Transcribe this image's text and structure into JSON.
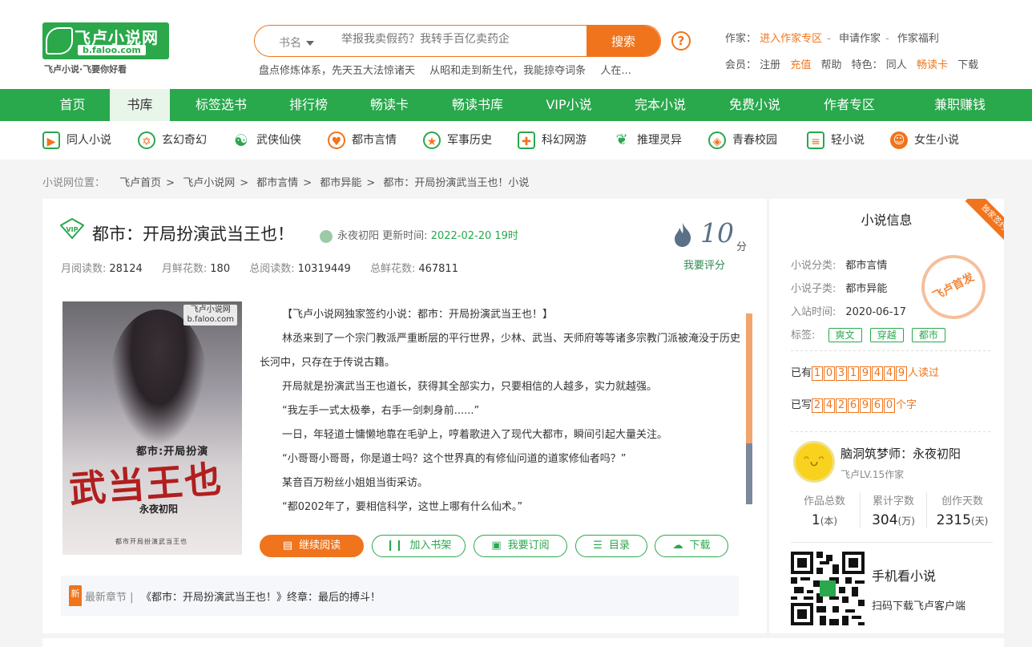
{
  "header": {
    "logo_name": "飞卢小说网",
    "logo_url": "b.faloo.com",
    "logo_slogan": "飞卢小说·飞要你好看",
    "search_category": "书名",
    "search_placeholder": "举报我卖假药？我转手百亿卖药企",
    "search_button": "搜索",
    "help_label": "?",
    "hot_searches": [
      "盘点修炼体系，先天五大法惊诸天",
      "从昭和走到新生代，我能掠夺词条",
      "人在..."
    ],
    "writer_label": "作家：",
    "writer_links": [
      "进入作家专区",
      "申请作家",
      "作家福利"
    ],
    "member_label": "会员：",
    "member_links": [
      "注册",
      "充值",
      "帮助"
    ],
    "feature_label": "特色：",
    "feature_links": [
      "同人",
      "畅读卡",
      "下载"
    ]
  },
  "nav": {
    "items": [
      "首页",
      "书库",
      "标签选书",
      "排行榜",
      "畅读卡",
      "畅读书库",
      "VIP小说",
      "完本小说",
      "免费小说",
      "作者专区",
      "兼职赚钱"
    ],
    "active": "书库"
  },
  "categories": [
    {
      "label": "同人小说",
      "icon": "entry-icon"
    },
    {
      "label": "玄幻奇幻",
      "icon": "hexagram-icon"
    },
    {
      "label": "武侠仙侠",
      "icon": "yin-yang-icon"
    },
    {
      "label": "都市言情",
      "icon": "heart-icon"
    },
    {
      "label": "军事历史",
      "icon": "star-badge-icon"
    },
    {
      "label": "科幻网游",
      "icon": "gamepad-icon"
    },
    {
      "label": "推理灵异",
      "icon": "leaf-icon"
    },
    {
      "label": "青春校园",
      "icon": "candy-icon"
    },
    {
      "label": "轻小说",
      "icon": "sliders-icon"
    },
    {
      "label": "女生小说",
      "icon": "girl-icon"
    }
  ],
  "breadcrumb": {
    "label": "小说网位置：",
    "items": [
      "飞卢首页",
      "飞卢小说网",
      "都市言情",
      "都市异能",
      "都市：开局扮演武当王也！小说"
    ]
  },
  "book": {
    "title": "都市：开局扮演武当王也！",
    "author": "永夜初阳",
    "update_label": "更新时间:",
    "update_time": "2022-02-20 19时",
    "stats": [
      {
        "label": "月阅读数:",
        "value": "28124"
      },
      {
        "label": "月鲜花数:",
        "value": "180"
      },
      {
        "label": "总阅读数:",
        "value": "10319449"
      },
      {
        "label": "总鲜花数:",
        "value": "467811"
      }
    ],
    "score": "10",
    "score_unit": "分",
    "rate_label": "我要评分",
    "cover": {
      "publisher": "飞卢小说网",
      "publisher_url": "b.faloo.com",
      "subtitle": "都市:开局扮演",
      "main": "武当王也",
      "author": "永夜初阳",
      "footer": "都市开局扮演武当王也"
    },
    "intro": [
      "【飞卢小说网独家签约小说：都市：开局扮演武当王也！】",
      "林丞来到了一个宗门教派严重断层的平行世界，少林、武当、天师府等等诸多宗教门派被淹没于历史长河中，只存在于传说古籍。",
      "开局就是扮演武当王也道长，获得其全部实力，只要相信的人越多，实力就越强。",
      "“我左手一式太极拳，右手一剑刺身前......”",
      "一日，年轻道士慵懒地靠在毛驴上，哼着歌进入了现代大都市，瞬间引起大量关注。",
      "“小哥哥小哥哥，你是道士吗？这个世界真的有修仙问道的道家修仙者吗？”",
      "某音百万粉丝小姐姐当街采访。",
      "“都0202年了，要相信科学，这世上哪有什么仙术。”"
    ],
    "actions": [
      "继续阅读",
      "加入书架",
      "我要订阅",
      "目录",
      "下载"
    ],
    "latest_tag": "新",
    "latest_label": "最新章节 |",
    "latest_chapter": "《都市：开局扮演武当王也！》终章：最后的搏斗！"
  },
  "sidebar": {
    "title": "小说信息",
    "badge": "独家签约",
    "stamp": "飞卢首发",
    "category_label": "小说分类:",
    "category": "都市言情",
    "subcategory_label": "小说子类:",
    "subcategory": "都市异能",
    "date_label": "入站时间:",
    "date": "2020-06-17",
    "tags_label": "标签:",
    "tags": [
      "爽文",
      "穿越",
      "都市"
    ],
    "read_prefix": "已有",
    "read_digits": [
      "1",
      "0",
      "3",
      "1",
      "9",
      "4",
      "4",
      "9"
    ],
    "read_suffix": "人读过",
    "written_prefix": "已写",
    "written_digits": [
      "2",
      "4",
      "2",
      "6",
      "9",
      "6",
      "0"
    ],
    "written_suffix": "个字",
    "writer_name": "脑洞筑梦师：永夜初阳",
    "writer_level": "飞卢LV.15作家",
    "writer_stats": [
      {
        "label": "作品总数",
        "value": "1",
        "unit": "(本)"
      },
      {
        "label": "累计字数",
        "value": "304",
        "unit": "(万)"
      },
      {
        "label": "创作天数",
        "value": "2315",
        "unit": "(天)"
      }
    ],
    "qr_title": "手机看小说",
    "qr_subtitle": "扫码下载飞卢客户端"
  },
  "colors": {
    "brand_green": "#29a84c",
    "accent_orange": "#f0741c"
  }
}
